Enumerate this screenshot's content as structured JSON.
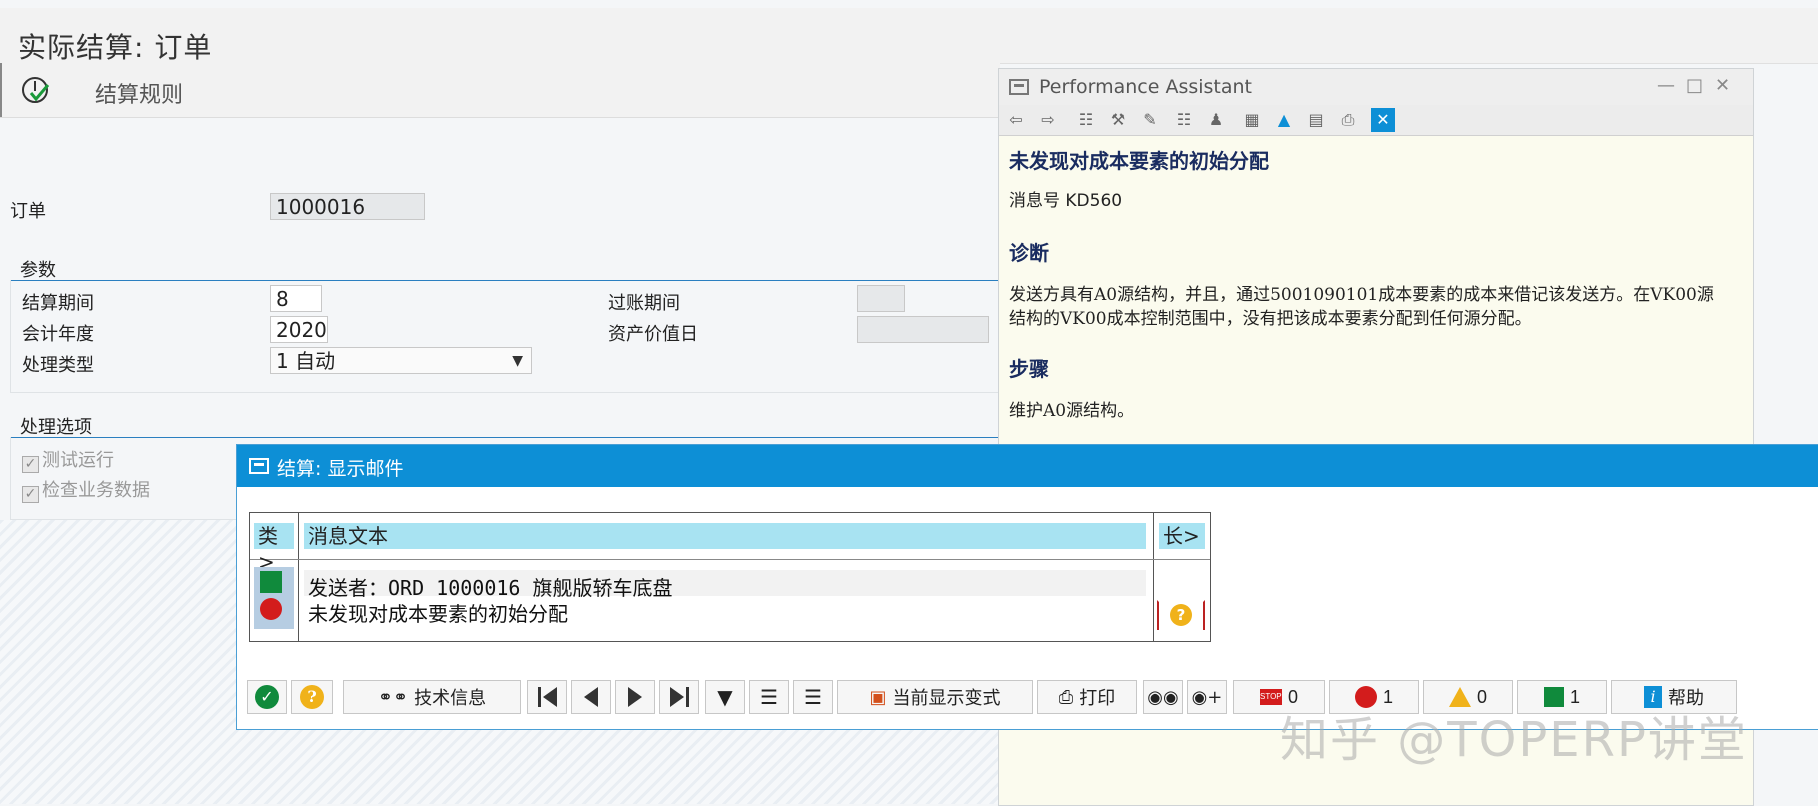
{
  "page": {
    "title": "实际结算: 订单",
    "toolbar_rules_label": "结算规则"
  },
  "order": {
    "label": "订单",
    "value": "1000016"
  },
  "params": {
    "group_title": "参数",
    "period_label": "结算期间",
    "period_value": "8",
    "fiscal_year_label": "会计年度",
    "fiscal_year_value": "2020",
    "processing_type_label": "处理类型",
    "processing_type_value": "1 自动",
    "posting_period_label": "过账期间",
    "asset_value_date_label": "资产价值日"
  },
  "options": {
    "group_title": "处理选项",
    "test_run_label": "测试运行",
    "check_business_label": "检查业务数据"
  },
  "assistant": {
    "title": "Performance Assistant",
    "heading": "未发现对成本要素的初始分配",
    "msg_no": "消息号 KD560",
    "diag_heading": "诊断",
    "diag_text": "发送方具有A0源结构，并且，通过5001090101成本要素的成本来借记该发送方。在VK00源结构的VK00成本控制范围中，没有把该成本要素分配到任何源分配。",
    "steps_heading": "步骤",
    "steps_text": "维护A0源结构。"
  },
  "dialog": {
    "title": "结算: 显示邮件",
    "col_type": "类>",
    "col_text": "消息文本",
    "col_long": "长>",
    "row1": "发送者：ORD 1000016 旗舰版轿车底盘",
    "row2": "未发现对成本要素的初始分配",
    "btn_tech_info": "技术信息",
    "btn_current_layout": "当前显示变式",
    "btn_print": "打印",
    "count_stop": "0",
    "count_error": "1",
    "count_warning": "0",
    "count_success": "1",
    "btn_help": "帮助"
  },
  "watermark": "知乎 @TOPERP讲堂",
  "colors": {
    "accent": "#0d8fd6",
    "success": "#108a3c",
    "error": "#d31c1c",
    "warning": "#f0b21a"
  }
}
